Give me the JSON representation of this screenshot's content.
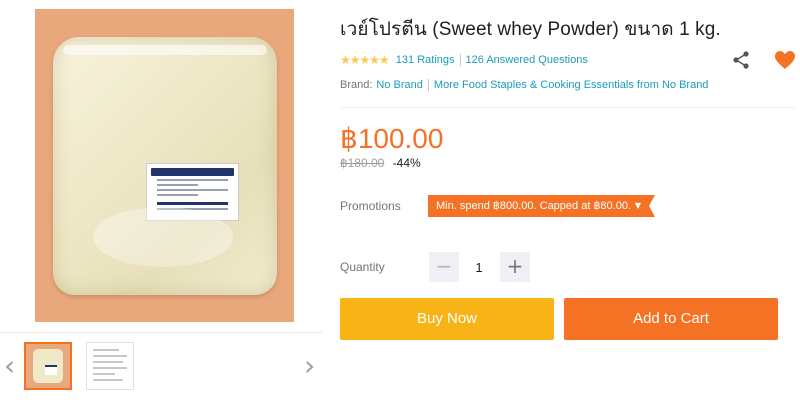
{
  "gallery": {
    "prev_icon": "chevron-left-icon",
    "next_icon": "chevron-right-icon",
    "prev_glyph": "‹",
    "next_glyph": "›"
  },
  "product": {
    "title": "เวย์โปรตีน (Sweet whey Powder) ขนาด 1 kg.",
    "stars_glyph": "★★★★★",
    "stars_rating": 4.5,
    "ratings_text": "131 Ratings",
    "questions_text": "126 Answered Questions",
    "brand_label": "Brand:",
    "brand_name": "No Brand",
    "more_link": "More Food Staples & Cooking Essentials from No Brand"
  },
  "pricing": {
    "price": "฿100.00",
    "original_price": "฿180.00",
    "discount": "-44%"
  },
  "promotions": {
    "label": "Promotions",
    "tag_text": "Min. spend ฿800.00. Capped at ฿80.00.",
    "caret": "▼"
  },
  "quantity": {
    "label": "Quantity",
    "value": "1",
    "minus": "−",
    "plus": "+"
  },
  "actions": {
    "buy_now": "Buy Now",
    "add_to_cart": "Add to Cart"
  },
  "colors": {
    "accent": "#f57224",
    "buy_now": "#f8b416",
    "link": "#1a9cb7",
    "star": "#faca51"
  }
}
